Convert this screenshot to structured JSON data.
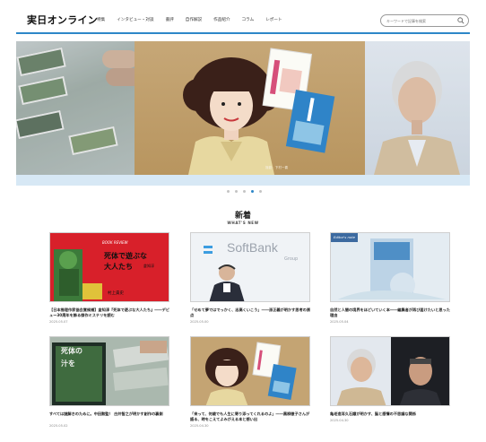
{
  "header": {
    "logo": "実日オンライン",
    "nav": [
      "特集",
      "インタビュー・対談",
      "書評",
      "自作解説",
      "作品紹介",
      "コラム",
      "レポート"
    ],
    "search_placeholder": "キーワードで記事を検索"
  },
  "hero": {
    "caption": "撮影：下村一喜",
    "dots_count": 5,
    "active_dot": 4
  },
  "section": {
    "title": "新着",
    "subtitle": "WHAT'S NEW"
  },
  "articles": [
    {
      "title": "【日本推理作家協会賞候補】倉知淳『死体で遊ぶな大人たち』――デビュー30周年を飾る傑作ミステリを読む",
      "date": "2025.05.07",
      "thumb_text": [
        "死体で遊ぶな",
        "大人たち",
        "倉知淳",
        "BOOK REVIEW",
        "村上貴史"
      ]
    },
    {
      "title": "「せめて夢ではでっかく、志高くいこう」――孫正義が明かす思考の原点",
      "date": "2025.05.00",
      "thumb_text": [
        "SoftBank",
        "Group"
      ]
    },
    {
      "title": "自然と人間の境界をほどいていく本――編集者が再び届けたいと思った理由",
      "date": "2025.05.04",
      "thumb_text": [
        "Editor's note"
      ]
    },
    {
      "title": "すべては謎解きのために。中田勲監！ 白井智之が明かす創作の裏側",
      "date": "2025.05.02",
      "thumb_text": [
        "死体の",
        "汁を"
      ]
    },
    {
      "title": "「来って、何歳でも人生に寄り添ってくれるのよ」――黒柳徹子さんが語る、時をこえてよみがえる本と想い出",
      "date": "2025.04.30",
      "thumb_text": []
    },
    {
      "title": "亀老造耳久石譲が明かす、脳と感情の不思議な関係",
      "date": "2025.04.30",
      "thumb_text": []
    }
  ],
  "colors": {
    "accent": "#2d87c8",
    "hero_bar": "#d7e8f5",
    "red_cover": "#d8202a"
  }
}
